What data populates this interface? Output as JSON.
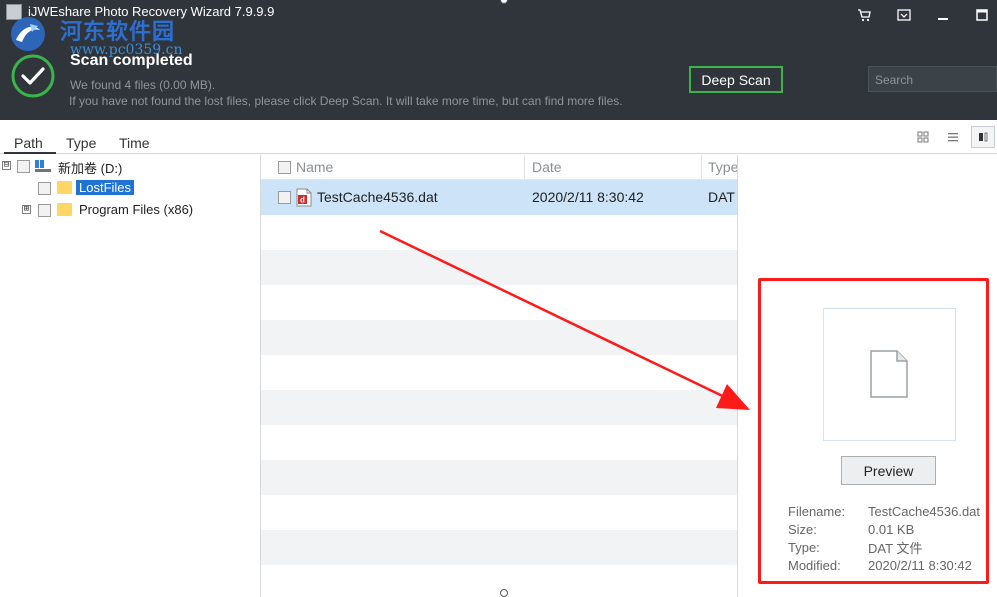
{
  "window": {
    "title": "iJWEshare Photo Recovery Wizard 7.9.9.9"
  },
  "watermark": {
    "text": "河东软件园",
    "url": "www.pc0359.cn"
  },
  "icons": {
    "app": "app-icon",
    "cart": "cart-icon",
    "register": "register-icon",
    "minimize": "minimize-icon",
    "maximize": "maximize-icon",
    "success": "check-circle-icon",
    "folder": "folder-icon",
    "drive": "drive-icon",
    "file_dat": "dat-file-icon",
    "preview_placeholder": "blank-document-icon",
    "view_grid": "grid-view-icon",
    "view_list": "list-view-icon",
    "view_detail": "detail-view-icon"
  },
  "colors": {
    "header_bg": "#2f353b",
    "accent_green": "#39b54a",
    "selection_blue": "#1f72d6",
    "row_highlight": "#cde3f7",
    "annotation_red": "#ff1a1a"
  },
  "scan": {
    "status": "Scan completed",
    "found": "We found 4 files (0.00 MB).",
    "hint": "If you have not found the lost files, please click Deep Scan. It will take more time, but can find more files.",
    "deep_scan_label": "Deep Scan"
  },
  "search": {
    "placeholder": "Search",
    "value": ""
  },
  "tabs": [
    {
      "label": "Path",
      "active": true
    },
    {
      "label": "Type",
      "active": false
    },
    {
      "label": "Time",
      "active": false
    }
  ],
  "tree": {
    "root": {
      "label": "新加卷 (D:)",
      "expander": "⊟"
    },
    "children": [
      {
        "label": "LostFiles",
        "selected": true
      },
      {
        "label": "Program Files (x86)",
        "expander": "⊞"
      }
    ]
  },
  "file_list": {
    "columns": [
      "Name",
      "Date",
      "Type"
    ],
    "rows": [
      {
        "name": "TestCache4536.dat",
        "date": "2020/2/11 8:30:42",
        "type": "DAT"
      }
    ]
  },
  "preview": {
    "button_label": "Preview",
    "info": [
      {
        "label": "Filename:",
        "value": "TestCache4536.dat"
      },
      {
        "label": "Size:",
        "value": "0.01 KB"
      },
      {
        "label": "Type:",
        "value": "DAT 文件"
      },
      {
        "label": "Modified:",
        "value": "2020/2/11 8:30:42"
      }
    ]
  }
}
